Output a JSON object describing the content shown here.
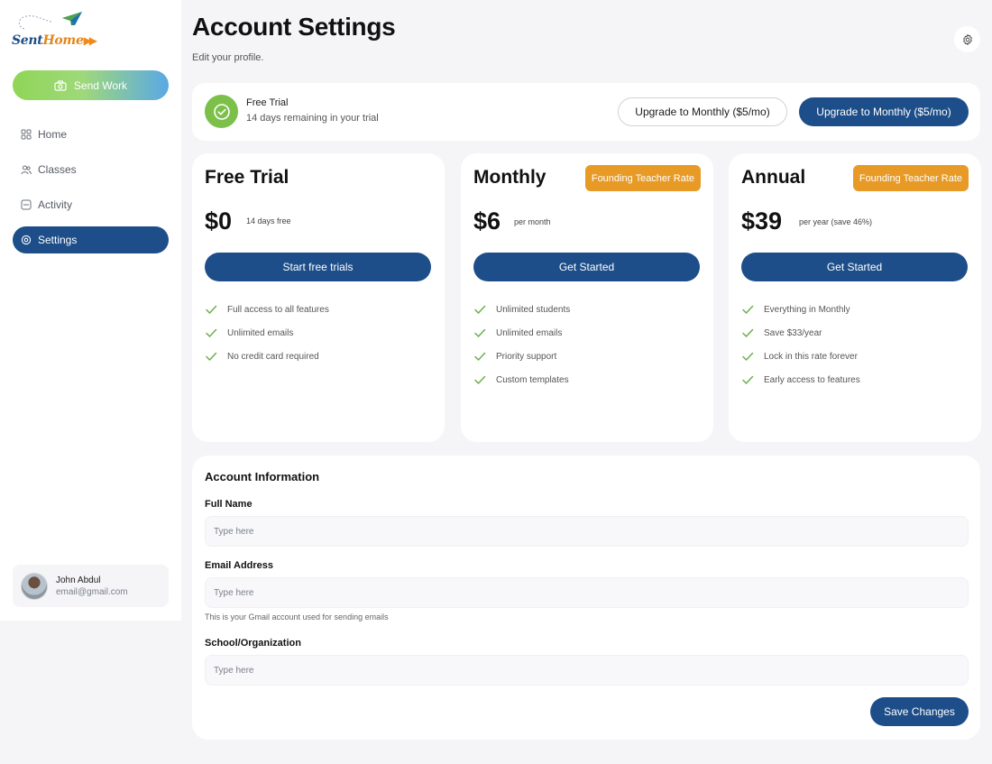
{
  "sidebar": {
    "logo": {
      "word1": "Sent",
      "word2": "Home",
      "arrows": "▶▶"
    },
    "send_work_label": "Send Work",
    "nav": [
      {
        "label": "Home",
        "icon": "grid-icon"
      },
      {
        "label": "Classes",
        "icon": "users-icon"
      },
      {
        "label": "Activity",
        "icon": "activity-icon"
      },
      {
        "label": "Settings",
        "icon": "settings-icon",
        "active": true
      }
    ],
    "user": {
      "name": "John Abdul",
      "email": "email@gmail.com"
    }
  },
  "header": {
    "title": "Account Settings",
    "subtitle": "Edit your profile."
  },
  "trial_banner": {
    "title": "Free Trial",
    "subtitle": "14 days remaining in your trial",
    "upgrade_outline_label": "Upgrade to Monthly ($5/mo)",
    "upgrade_solid_label": "Upgrade to Monthly ($5/mo)"
  },
  "plans": [
    {
      "name": "Free Trial",
      "badge": "",
      "price": "$0",
      "note": "14 days free",
      "button": "Start free trials",
      "features": [
        "Full access to all features",
        "Unlimited emails",
        "No credit card required"
      ]
    },
    {
      "name": "Monthly",
      "badge": "Founding Teacher Rate",
      "price": "$6",
      "note": "per month",
      "button": "Get Started",
      "features": [
        "Unlimited students",
        "Unlimited emails",
        "Priority support",
        "Custom templates"
      ]
    },
    {
      "name": "Annual",
      "badge": "Founding Teacher Rate",
      "price": "$39",
      "note": "per year (save 46%)",
      "button": "Get Started",
      "features": [
        "Everything in Monthly",
        "Save $33/year",
        "Lock in this rate forever",
        "Early access to features"
      ]
    }
  ],
  "account": {
    "title": "Account Information",
    "full_name": {
      "label": "Full Name",
      "value": "",
      "placeholder": "Type here"
    },
    "email": {
      "label": "Email Address",
      "value": "",
      "placeholder": "Type here",
      "hint": "This is your Gmail account used for sending emails"
    },
    "school": {
      "label": "School/Organization",
      "value": "",
      "placeholder": "Type here"
    },
    "save_label": "Save Changes"
  },
  "colors": {
    "primary": "#1d4e89",
    "badge": "#e89a26",
    "success": "#7cc04a",
    "check": "#6ab04c"
  }
}
